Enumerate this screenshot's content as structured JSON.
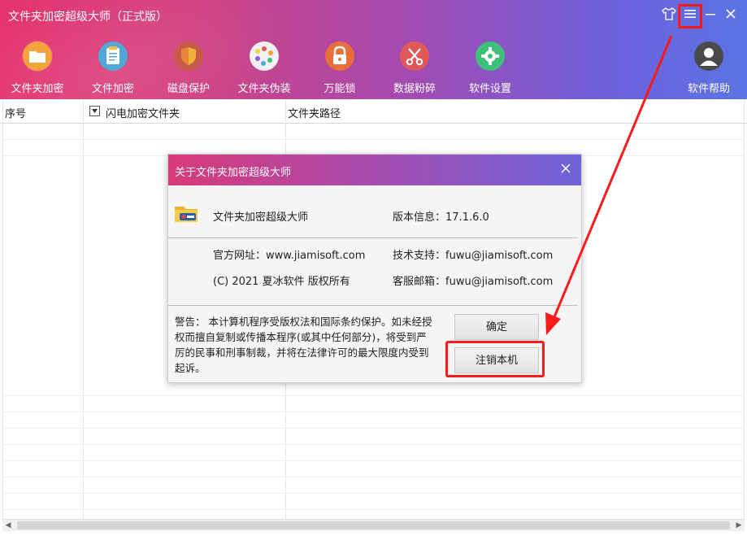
{
  "window": {
    "title": "文件夹加密超级大师（正式版）",
    "controls": [
      {
        "name": "skin-icon",
        "glyph": "👕"
      },
      {
        "name": "menu-icon",
        "glyph": "☰"
      },
      {
        "name": "minimize-icon",
        "glyph": "—"
      },
      {
        "name": "close-icon",
        "glyph": "✕"
      }
    ]
  },
  "toolbar": [
    {
      "label": "文件夹加密",
      "icon": "folder-icon",
      "color": "#f3a33a"
    },
    {
      "label": "文件加密",
      "icon": "document-icon",
      "color": "#4fa8d8"
    },
    {
      "label": "磁盘保护",
      "icon": "shield-icon",
      "color": "#e8863a"
    },
    {
      "label": "文件夹伪装",
      "icon": "palette-icon",
      "color": "#f1f1f1"
    },
    {
      "label": "万能锁",
      "icon": "lock-icon",
      "color": "#e86f39"
    },
    {
      "label": "数据粉碎",
      "icon": "scissors-icon",
      "color": "#e05858"
    },
    {
      "label": "软件设置",
      "icon": "gear-icon",
      "color": "#3fbf7a"
    },
    {
      "label": "软件帮助",
      "icon": "user-icon",
      "color": "#4a4a4a"
    }
  ],
  "table": {
    "headers": [
      "序号",
      "闪电加密文件夹",
      "文件夹路径"
    ]
  },
  "dialog": {
    "title": "关于文件夹加密超级大师",
    "product_name": "文件夹加密超级大师",
    "version_label": "版本信息：",
    "version": "17.1.6.0",
    "website_label": "官方网址：",
    "website": "www.jiamisoft.com",
    "support_label": "技术支持：",
    "support": "fuwu@jiamisoft.com",
    "copyright": "(C) 2021 夏冰软件 版权所有",
    "service_label": "客服邮箱：",
    "service": "fuwu@jiamisoft.com",
    "warning": "警告： 本计算机程序受版权法和国际条约保护。如未经授权而擅自复制或传播本程序(或其中任何部分)，将受到严厉的民事和刑事制裁，并将在法律许可的最大限度内受到起诉。",
    "ok_label": "确定",
    "deregister_label": "注销本机"
  },
  "annotation_color": "#ff1a1a"
}
